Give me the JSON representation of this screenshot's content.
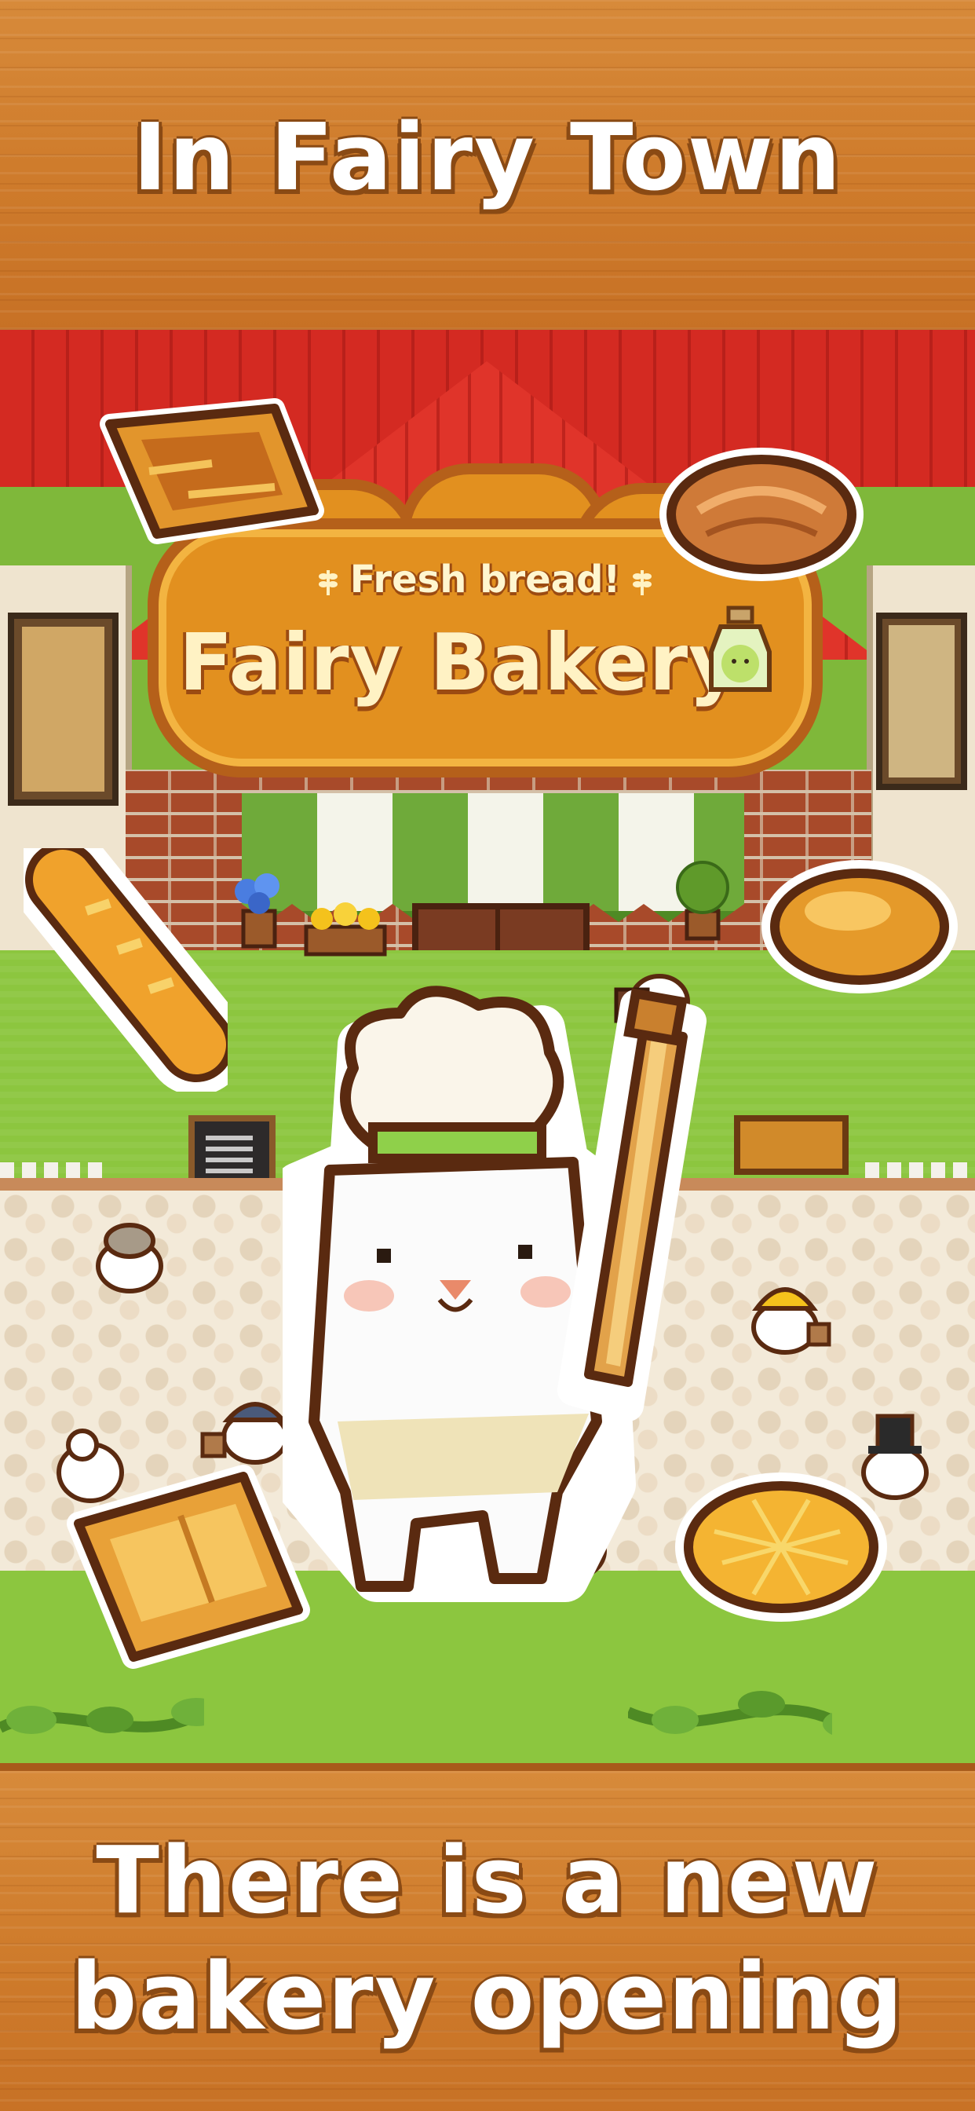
{
  "headline_top": "In Fairy Town",
  "headline_bottom": {
    "line1": "There is a new",
    "line2": "bakery opening"
  },
  "shop_sign": {
    "subtitle": "Fresh bread!",
    "title": "Fairy Bakery"
  },
  "colors": {
    "wood": "#cf7c2c",
    "roof_red": "#d42a22",
    "awning_green": "#6faa3a",
    "lawn_green": "#8cc63f",
    "sign_orange": "#e2901f",
    "outline_brown": "#5a2a10"
  },
  "icons": [
    "croissant-icon",
    "bread-loaf-icon",
    "baguette-icon",
    "bun-icon",
    "toast-loaf-icon",
    "melon-bread-icon",
    "chef-cat-icon",
    "rolling-pin-icon",
    "jar-icon",
    "wheat-icon",
    "vine-icon"
  ]
}
